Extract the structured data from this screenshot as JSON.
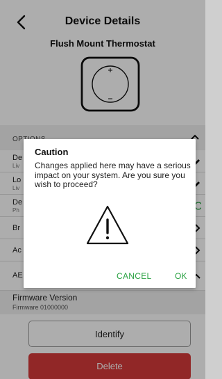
{
  "header": {
    "title": "Device Details",
    "device_name": "Flush Mount Thermostat",
    "back_icon": "chevron-left-icon"
  },
  "options": {
    "label": "OPTIONS",
    "chevron_icon": "chevron-up-icon",
    "rows": [
      {
        "label": "De",
        "sub": "Liv",
        "right_icon": "pencil-icon"
      },
      {
        "label": "Lo",
        "sub": "Liv",
        "right_icon": "pencil-icon"
      },
      {
        "label": "De",
        "sub": "Ph",
        "right_icon": "toggle-icon"
      },
      {
        "label": "Br",
        "sub": "",
        "right_icon": "chevron-right-icon"
      },
      {
        "label": "Ac",
        "sub": "",
        "right_icon": "chevron-right-icon"
      },
      {
        "label": "AE",
        "sub": "",
        "right_icon": "chevron-up-icon"
      }
    ]
  },
  "firmware": {
    "label": "Firmware Version",
    "value": "Firmware 01000000"
  },
  "buttons": {
    "identify": "Identify",
    "delete": "Delete"
  },
  "dialog": {
    "title": "Caution",
    "message": "Changes applied here may have a serious impact on your system. Are you sure you wish to proceed?",
    "icon": "warning-triangle-icon",
    "cancel": "CANCEL",
    "ok": "OK"
  },
  "colors": {
    "accent_green": "#2aa243",
    "delete_red": "#d63a3a"
  }
}
